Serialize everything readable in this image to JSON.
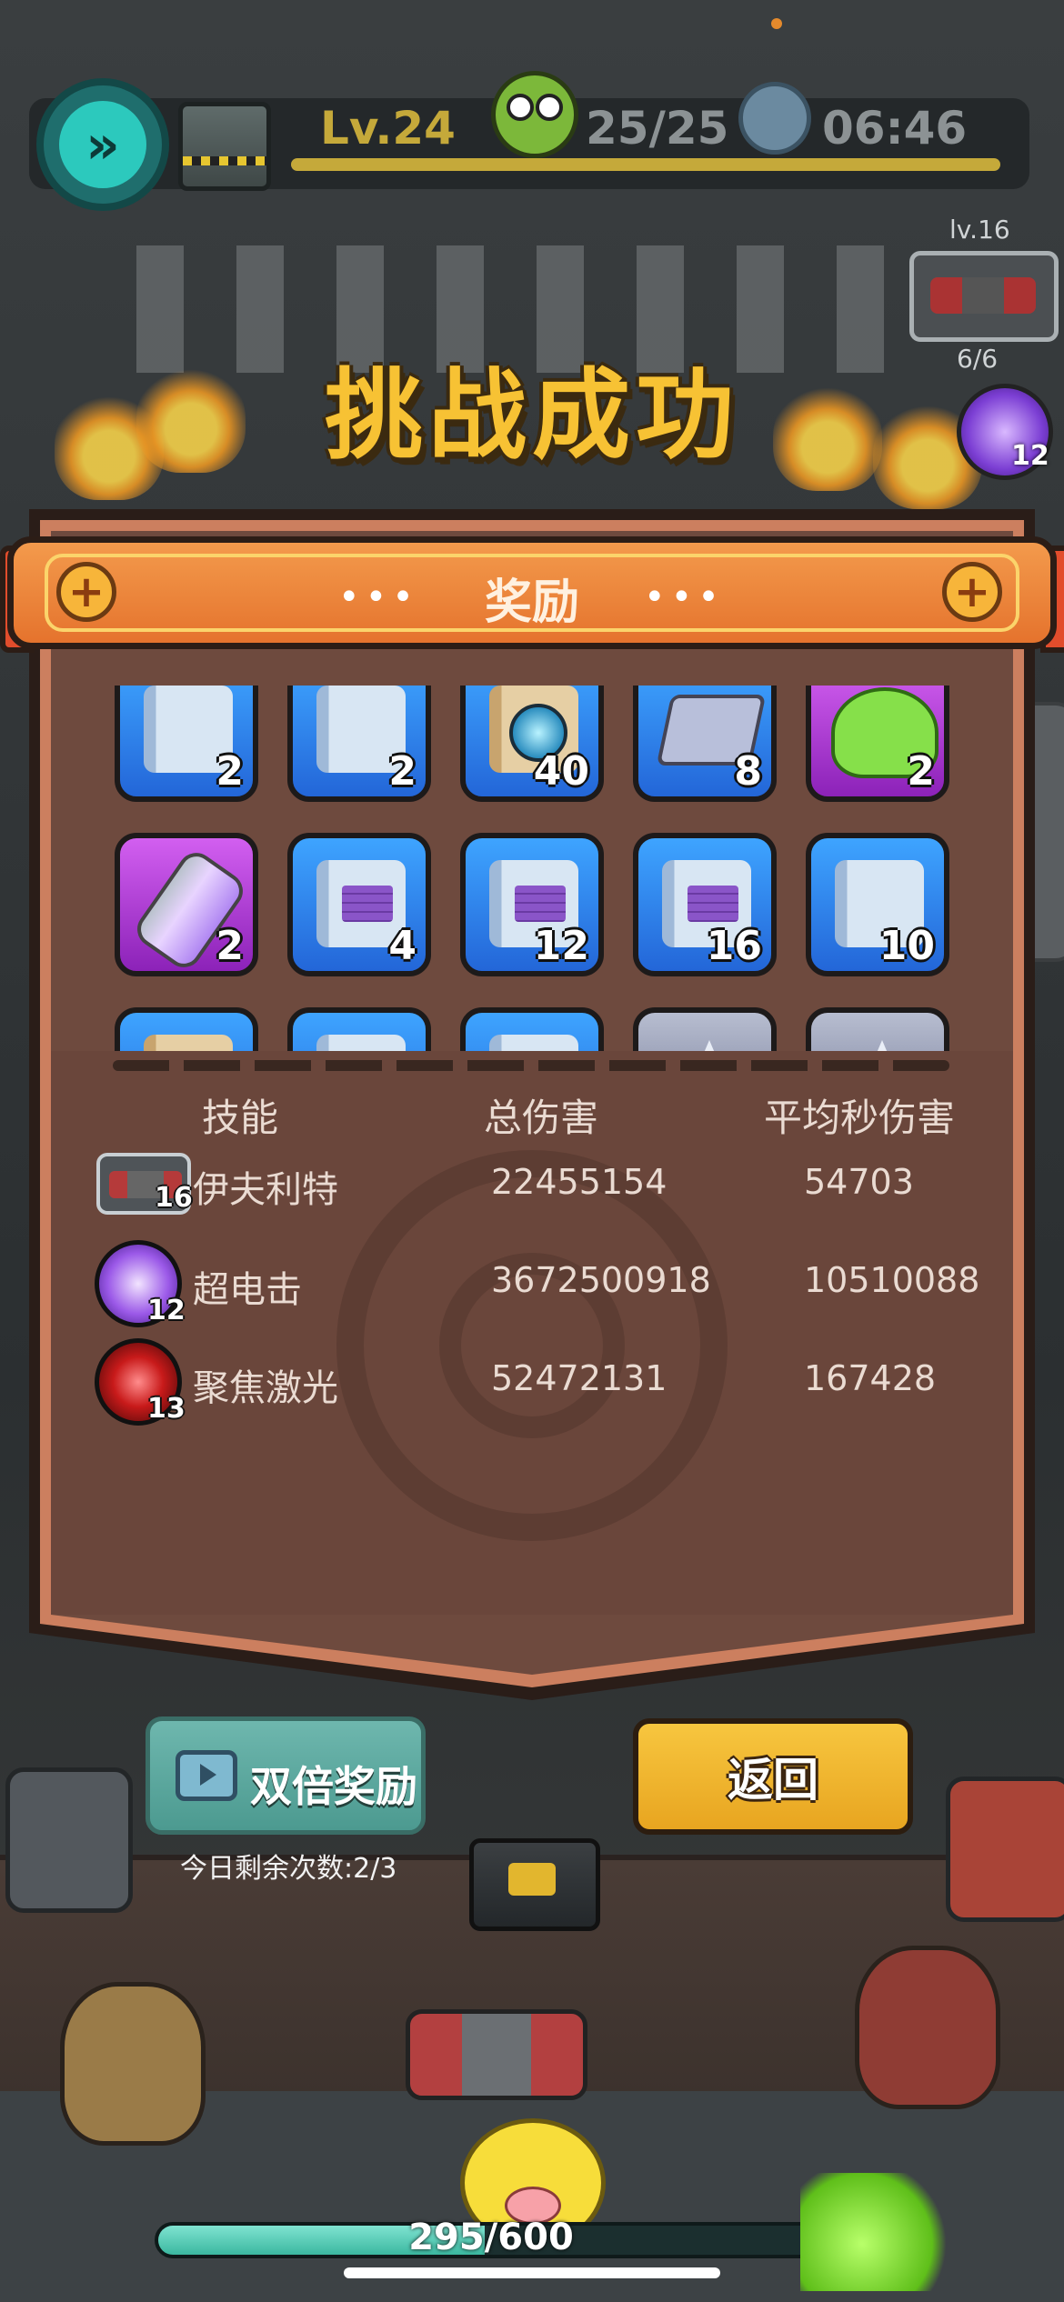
{
  "hud": {
    "level": "Lv.24",
    "wave_count": "25/25",
    "timer": "06:46",
    "fast_forward_icon": "double-chevron-right-icon"
  },
  "side": {
    "weapon_level": "lv.16",
    "slot_count": "6/6",
    "skill_level": "12",
    "collapse_arrow": "‹"
  },
  "title": "挑战成功",
  "rewards_panel": {
    "title": "奖励",
    "dots": "•••",
    "row1": [
      {
        "icon": "belt-blueprint-icon",
        "qty": "2",
        "rarity": "blue",
        "art": "scroll"
      },
      {
        "icon": "armor-blueprint-icon",
        "qty": "2",
        "rarity": "blue",
        "art": "shirt"
      },
      {
        "icon": "gem-scroll-icon",
        "qty": "40",
        "rarity": "blue",
        "art": "gem"
      },
      {
        "icon": "metal-ingot-icon",
        "qty": "8",
        "rarity": "blue",
        "art": "metal"
      },
      {
        "icon": "slime-icon",
        "qty": "2",
        "rarity": "purple",
        "art": "slime"
      }
    ],
    "row2": [
      {
        "icon": "capsule-icon",
        "qty": "2",
        "rarity": "purple",
        "art": "capsule"
      },
      {
        "icon": "wall-blueprint-icon",
        "qty": "4",
        "rarity": "blue",
        "art": "wall-bp"
      },
      {
        "icon": "wall-blueprint-icon",
        "qty": "12",
        "rarity": "blue",
        "art": "wall-bp"
      },
      {
        "icon": "wall-blueprint-icon",
        "qty": "16",
        "rarity": "blue",
        "art": "wall-bp"
      },
      {
        "icon": "belt-blueprint-icon",
        "qty": "10",
        "rarity": "blue",
        "art": "scroll"
      }
    ],
    "row3": [
      {
        "icon": "scroll-icon",
        "qty": "",
        "rarity": "blue",
        "art": "gem"
      },
      {
        "icon": "scroll-icon",
        "qty": "",
        "rarity": "blue",
        "art": "scroll"
      },
      {
        "icon": "scroll-icon",
        "qty": "",
        "rarity": "blue",
        "art": "scroll"
      },
      {
        "icon": "spike-icon",
        "qty": "",
        "rarity": "gray",
        "art": "spike"
      },
      {
        "icon": "spike-icon",
        "qty": "",
        "rarity": "gray",
        "art": "spike"
      }
    ]
  },
  "stats": {
    "headers": {
      "skill": "技能",
      "total_damage": "总伤害",
      "dps": "平均秒伤害"
    },
    "rows": [
      {
        "icon": "weapon-icon",
        "level": "16",
        "name": "伊夫利特",
        "total": "22455154",
        "dps": "54703"
      },
      {
        "icon": "electric-icon",
        "level": "12",
        "name": "超电击",
        "total": "3672500918",
        "dps": "10510088"
      },
      {
        "icon": "laser-icon",
        "level": "13",
        "name": "聚焦激光",
        "total": "52472131",
        "dps": "167428"
      }
    ]
  },
  "buttons": {
    "double_reward": "双倍奖励",
    "remaining": "今日剩余次数:2/3",
    "return": "返回"
  },
  "hp": {
    "text": "295/600",
    "fraction": 0.49
  },
  "colors": {
    "title": "#f7c234",
    "ribbon": "#e5732d",
    "panel": "#6e4a3e",
    "return_button": "#f0b52c",
    "double_button": "#5fa9a0"
  }
}
